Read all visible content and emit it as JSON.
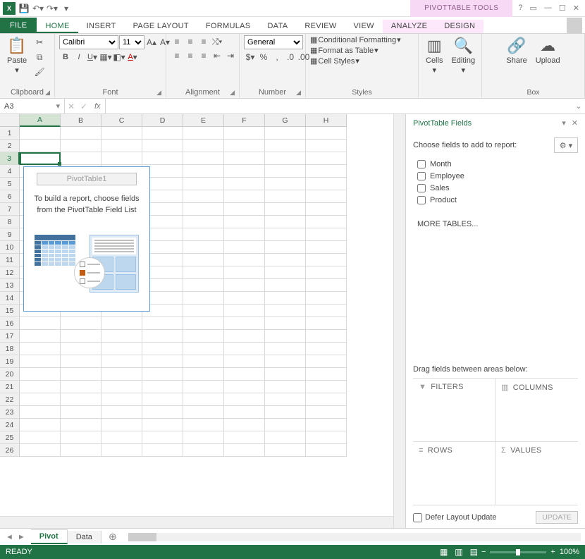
{
  "title_context": "PIVOTTABLE TOOLS",
  "tabs": {
    "file": "FILE",
    "home": "HOME",
    "insert": "INSERT",
    "pagelayout": "PAGE LAYOUT",
    "formulas": "FORMULAS",
    "data": "DATA",
    "review": "REVIEW",
    "view": "VIEW",
    "analyze": "ANALYZE",
    "design": "DESIGN"
  },
  "ribbon": {
    "clipboard": {
      "paste": "Paste",
      "label": "Clipboard"
    },
    "font": {
      "name": "Calibri",
      "size": "11",
      "label": "Font"
    },
    "alignment": {
      "label": "Alignment"
    },
    "number": {
      "sel": "General",
      "label": "Number"
    },
    "styles": {
      "cf": "Conditional Formatting",
      "tbl": "Format as Table",
      "cs": "Cell Styles",
      "label": "Styles"
    },
    "cells": {
      "cells": "Cells",
      "editing": "Editing"
    },
    "box": {
      "share": "Share",
      "upload": "Upload",
      "label": "Box"
    }
  },
  "namebox": "A3",
  "columns": [
    "A",
    "B",
    "C",
    "D",
    "E",
    "F",
    "G",
    "H"
  ],
  "rows": [
    "1",
    "2",
    "3",
    "4",
    "5",
    "6",
    "7",
    "8",
    "9",
    "10",
    "11",
    "12",
    "13",
    "14",
    "15",
    "16",
    "17",
    "18",
    "19",
    "20",
    "21",
    "22",
    "23",
    "24",
    "25",
    "26"
  ],
  "pivot": {
    "title": "PivotTable1",
    "msg": "To build a report, choose fields from the PivotTable Field List"
  },
  "panel": {
    "title": "PivotTable Fields",
    "prompt": "Choose fields to add to report:",
    "fields": [
      "Month",
      "Employee",
      "Sales",
      "Product"
    ],
    "more": "MORE TABLES...",
    "drag": "Drag fields between areas below:",
    "filters": "FILTERS",
    "columns": "COLUMNS",
    "rowsL": "ROWS",
    "values": "VALUES",
    "defer": "Defer Layout Update",
    "update": "UPDATE"
  },
  "sheets": {
    "pivot": "Pivot",
    "data": "Data"
  },
  "status": {
    "ready": "READY",
    "zoom": "100%"
  }
}
